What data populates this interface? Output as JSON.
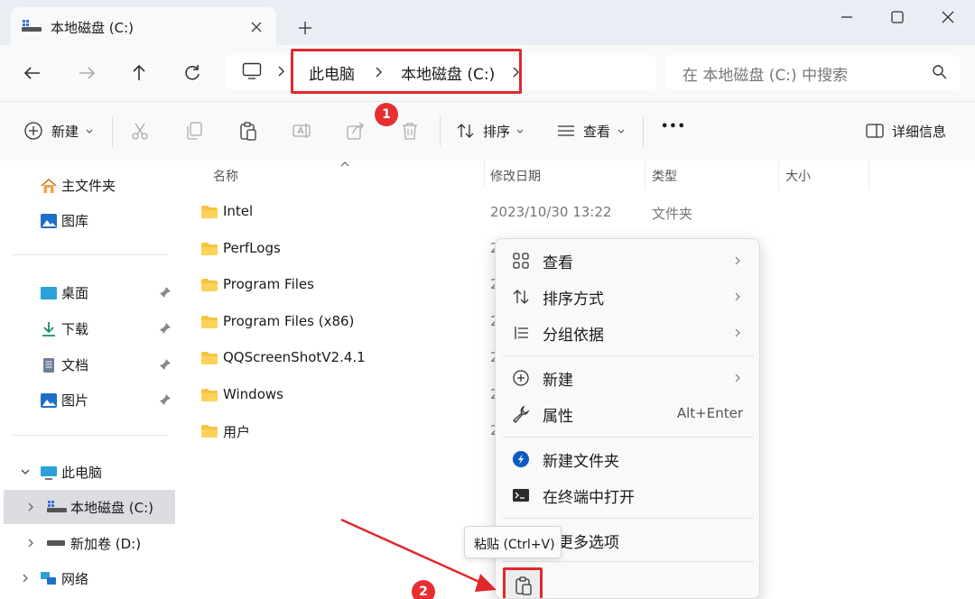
{
  "tab": {
    "title": "本地磁盘 (C:)"
  },
  "breadcrumb": {
    "items": [
      "此电脑",
      "本地磁盘 (C:)"
    ]
  },
  "search": {
    "placeholder": "在 本地磁盘 (C:) 中搜索"
  },
  "toolbar": {
    "new_label": "新建",
    "sort_label": "排序",
    "view_label": "查看",
    "more_label": "•••",
    "details_label": "详细信息"
  },
  "annotations": {
    "badge1": "1",
    "badge2": "2",
    "accent": "#e0292d"
  },
  "sidebar": {
    "items": [
      {
        "label": "主文件夹",
        "icon": "home-icon"
      },
      {
        "label": "图库",
        "icon": "gallery-icon"
      },
      {
        "label": "桌面",
        "icon": "desktop-icon",
        "pinned": true
      },
      {
        "label": "下载",
        "icon": "download-icon",
        "pinned": true
      },
      {
        "label": "文档",
        "icon": "document-icon",
        "pinned": true
      },
      {
        "label": "图片",
        "icon": "pictures-icon",
        "pinned": true
      },
      {
        "label": "此电脑",
        "icon": "this-pc-icon",
        "expanded": true
      },
      {
        "label": "本地磁盘 (C:)",
        "icon": "drive-icon",
        "selected": true
      },
      {
        "label": "新加卷 (D:)",
        "icon": "drive-icon"
      },
      {
        "label": "网络",
        "icon": "network-icon"
      }
    ]
  },
  "columns": {
    "name": "名称",
    "modified": "修改日期",
    "type": "类型",
    "size": "大小"
  },
  "files": [
    {
      "name": "Intel",
      "modified": "2023/10/30 13:22",
      "type": "文件夹"
    },
    {
      "name": "PerfLogs",
      "modified": "2"
    },
    {
      "name": "Program Files",
      "modified": "2"
    },
    {
      "name": "Program Files (x86)",
      "modified": "2"
    },
    {
      "name": "QQScreenShotV2.4.1",
      "modified": "2"
    },
    {
      "name": "Windows",
      "modified": "2"
    },
    {
      "name": "用户",
      "modified": "2"
    }
  ],
  "context_menu": {
    "items": [
      {
        "label": "查看",
        "icon": "grid-view-icon",
        "submenu": true
      },
      {
        "label": "排序方式",
        "icon": "sort-icon",
        "submenu": true
      },
      {
        "label": "分组依据",
        "icon": "group-by-icon",
        "submenu": true
      },
      {
        "label": "新建",
        "icon": "new-plus-icon",
        "submenu": true
      },
      {
        "label": "属性",
        "icon": "wrench-icon",
        "shortcut": "Alt+Enter"
      },
      {
        "label": "新建文件夹",
        "icon": "new-folder-icon"
      },
      {
        "label": "在终端中打开",
        "icon": "terminal-icon"
      },
      {
        "label": "示更多选项",
        "icon": "more-options-icon"
      }
    ],
    "paste_icon": "paste-icon"
  },
  "tooltip": {
    "text": "粘贴 (Ctrl+V)"
  }
}
